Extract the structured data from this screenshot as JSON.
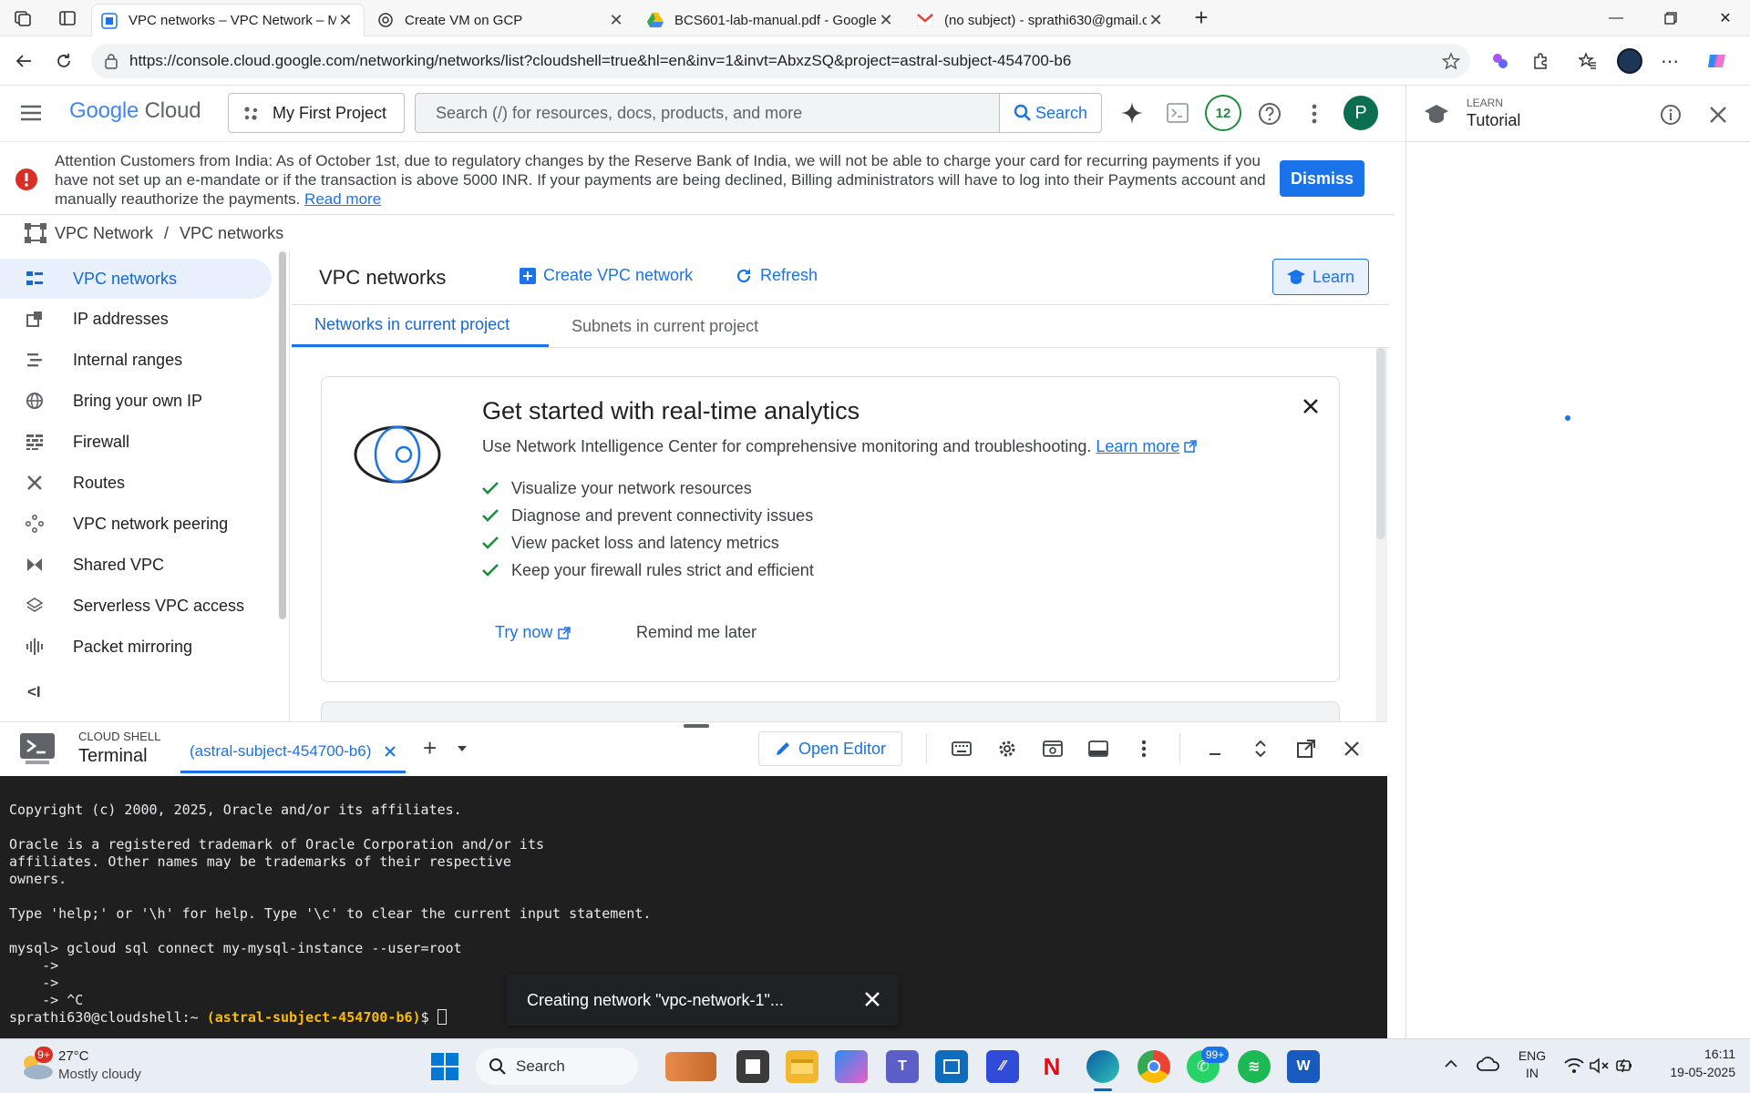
{
  "browser": {
    "tabs": [
      {
        "title": "VPC networks – VPC Network – M",
        "active": true
      },
      {
        "title": "Create VM on GCP",
        "active": false
      },
      {
        "title": "BCS601-lab-manual.pdf - Google",
        "active": false
      },
      {
        "title": "(no subject) - sprathi630@gmail.c",
        "active": false
      }
    ],
    "url": "https://console.cloud.google.com/networking/networks/list?cloudshell=true&hl=en&inv=1&invt=AbxzSQ&project=astral-subject-454700-b6"
  },
  "gcp_header": {
    "logo_google": "Google",
    "logo_cloud": "Cloud",
    "project": "My First Project",
    "search_placeholder": "Search (/) for resources, docs, products, and more",
    "search_button": "Search",
    "notifications_count": "12",
    "avatar_letter": "P"
  },
  "banner": {
    "text": "Attention Customers from India: As of October 1st, due to regulatory changes by the Reserve Bank of India, we will not be able to charge your card for recurring payments if you have not set up an e-mandate or if the transaction is above 5000 INR. If your payments are being declined, Billing administrators will have to log into their Payments account and manually reauthorize the payments.",
    "read_more": "Read more",
    "dismiss": "Dismiss"
  },
  "breadcrumb": {
    "root": "VPC Network",
    "sep": "/",
    "current": "VPC networks"
  },
  "sidebar": {
    "items": [
      {
        "label": "VPC networks",
        "icon": "vpc-icon",
        "active": true
      },
      {
        "label": "IP addresses",
        "icon": "ip-address-icon"
      },
      {
        "label": "Internal ranges",
        "icon": "internal-ranges-icon"
      },
      {
        "label": "Bring your own IP",
        "icon": "globe-icon"
      },
      {
        "label": "Firewall",
        "icon": "firewall-icon"
      },
      {
        "label": "Routes",
        "icon": "routes-icon"
      },
      {
        "label": "VPC network peering",
        "icon": "peering-icon"
      },
      {
        "label": "Shared VPC",
        "icon": "shared-vpc-icon"
      },
      {
        "label": "Serverless VPC access",
        "icon": "serverless-icon"
      },
      {
        "label": "Packet mirroring",
        "icon": "packet-mirroring-icon"
      }
    ],
    "collapse": "<I"
  },
  "main": {
    "title": "VPC networks",
    "create_btn": "Create VPC network",
    "refresh_btn": "Refresh",
    "learn_btn": "Learn",
    "tabs": [
      "Networks in current project",
      "Subnets in current project"
    ],
    "card": {
      "title": "Get started with real-time analytics",
      "subtitle": "Use Network Intelligence Center for comprehensive monitoring and troubleshooting.",
      "learn_more": "Learn more",
      "checks": [
        "Visualize your network resources",
        "Diagnose and prevent connectivity issues",
        "View packet loss and latency metrics",
        "Keep your firewall rules strict and efficient"
      ],
      "try_now": "Try now",
      "remind": "Remind me later"
    }
  },
  "right_panel": {
    "eyebrow": "LEARN",
    "title": "Tutorial"
  },
  "shell": {
    "eyebrow": "CLOUD SHELL",
    "title": "Terminal",
    "tab": "(astral-subject-454700-b6)",
    "open_editor": "Open Editor",
    "lines": [
      "Copyright (c) 2000, 2025, Oracle and/or its affiliates.",
      "",
      "Oracle is a registered trademark of Oracle Corporation and/or its",
      "affiliates. Other names may be trademarks of their respective",
      "owners.",
      "",
      "Type 'help;' or '\\h' for help. Type '\\c' to clear the current input statement.",
      "",
      "mysql> gcloud sql connect my-mysql-instance --user=root",
      "    ->",
      "    ->",
      "    -> ^C"
    ],
    "prompt_user": "sprathi630@cloudshell:~",
    "prompt_project": "(astral-subject-454700-b6)",
    "prompt_end": "$",
    "toast": "Creating network \"vpc-network-1\"..."
  },
  "taskbar": {
    "weather_badge": "9+",
    "weather_temp": "27°C",
    "weather_desc": "Mostly cloudy",
    "search": "Search",
    "whatsapp_badge": "99+",
    "lang1": "ENG",
    "lang2": "IN",
    "time": "16:11",
    "date": "19-05-2025"
  },
  "colors": {
    "accent": "#1a73e8",
    "banner_error": "#d93025",
    "terminal_bg": "#1f1f1f",
    "prompt_project": "#fbbc04"
  }
}
